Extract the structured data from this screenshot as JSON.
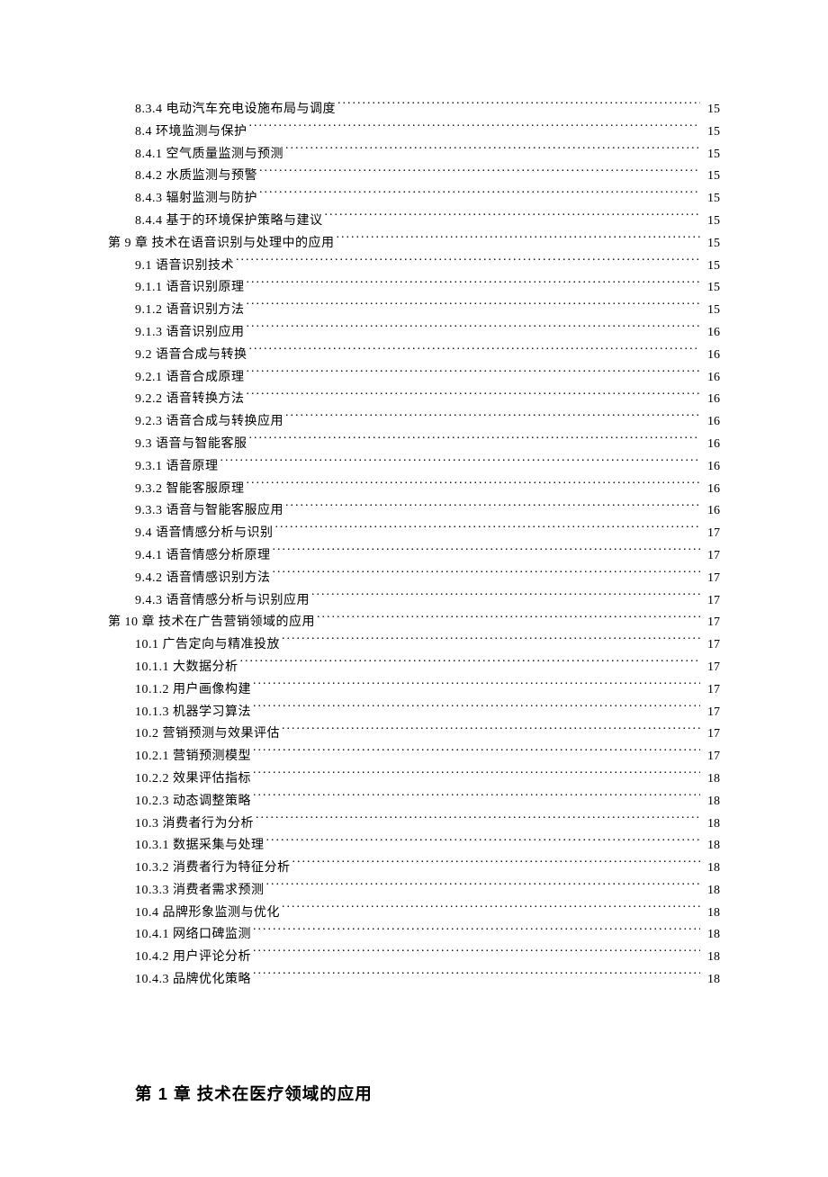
{
  "toc": [
    {
      "level": 1,
      "title": "8.3.4 电动汽车充电设施布局与调度",
      "page": "15"
    },
    {
      "level": 1,
      "title": "8.4 环境监测与保护",
      "page": "15"
    },
    {
      "level": 1,
      "title": "8.4.1 空气质量监测与预测",
      "page": "15"
    },
    {
      "level": 1,
      "title": "8.4.2 水质监测与预警",
      "page": "15"
    },
    {
      "level": 1,
      "title": "8.4.3 辐射监测与防护",
      "page": "15"
    },
    {
      "level": 1,
      "title": "8.4.4 基于的环境保护策略与建议",
      "page": "15"
    },
    {
      "level": 0,
      "title": "第 9 章 技术在语音识别与处理中的应用",
      "page": "15"
    },
    {
      "level": 1,
      "title": "9.1 语音识别技术",
      "page": "15"
    },
    {
      "level": 1,
      "title": "9.1.1 语音识别原理",
      "page": "15"
    },
    {
      "level": 1,
      "title": "9.1.2 语音识别方法",
      "page": "15"
    },
    {
      "level": 1,
      "title": "9.1.3 语音识别应用",
      "page": "16"
    },
    {
      "level": 1,
      "title": "9.2 语音合成与转换",
      "page": "16"
    },
    {
      "level": 1,
      "title": "9.2.1 语音合成原理",
      "page": "16"
    },
    {
      "level": 1,
      "title": "9.2.2 语音转换方法",
      "page": "16"
    },
    {
      "level": 1,
      "title": "9.2.3 语音合成与转换应用",
      "page": "16"
    },
    {
      "level": 1,
      "title": "9.3 语音与智能客服",
      "page": "16"
    },
    {
      "level": 1,
      "title": "9.3.1 语音原理",
      "page": "16"
    },
    {
      "level": 1,
      "title": "9.3.2 智能客服原理",
      "page": "16"
    },
    {
      "level": 1,
      "title": "9.3.3 语音与智能客服应用",
      "page": "16"
    },
    {
      "level": 1,
      "title": "9.4 语音情感分析与识别",
      "page": "17"
    },
    {
      "level": 1,
      "title": "9.4.1 语音情感分析原理",
      "page": "17"
    },
    {
      "level": 1,
      "title": "9.4.2 语音情感识别方法",
      "page": "17"
    },
    {
      "level": 1,
      "title": "9.4.3 语音情感分析与识别应用",
      "page": "17"
    },
    {
      "level": 0,
      "title": "第 10 章 技术在广告营销领域的应用",
      "page": "17"
    },
    {
      "level": 1,
      "title": "10.1 广告定向与精准投放",
      "page": "17"
    },
    {
      "level": 1,
      "title": "10.1.1 大数据分析",
      "page": "17"
    },
    {
      "level": 1,
      "title": "10.1.2 用户画像构建",
      "page": "17"
    },
    {
      "level": 1,
      "title": "10.1.3 机器学习算法",
      "page": "17"
    },
    {
      "level": 1,
      "title": "10.2 营销预测与效果评估",
      "page": "17"
    },
    {
      "level": 1,
      "title": "10.2.1 营销预测模型",
      "page": "17"
    },
    {
      "level": 1,
      "title": "10.2.2 效果评估指标",
      "page": "18"
    },
    {
      "level": 1,
      "title": "10.2.3 动态调整策略",
      "page": "18"
    },
    {
      "level": 1,
      "title": "10.3 消费者行为分析",
      "page": "18"
    },
    {
      "level": 1,
      "title": "10.3.1 数据采集与处理",
      "page": "18"
    },
    {
      "level": 1,
      "title": "10.3.2 消费者行为特征分析",
      "page": "18"
    },
    {
      "level": 1,
      "title": "10.3.3 消费者需求预测",
      "page": "18"
    },
    {
      "level": 1,
      "title": "10.4 品牌形象监测与优化",
      "page": "18"
    },
    {
      "level": 1,
      "title": "10.4.1 网络口碑监测",
      "page": "18"
    },
    {
      "level": 1,
      "title": "10.4.2 用户评论分析",
      "page": "18"
    },
    {
      "level": 1,
      "title": "10.4.3 品牌优化策略",
      "page": "18"
    }
  ],
  "heading": "第 1 章 技术在医疗领域的应用"
}
